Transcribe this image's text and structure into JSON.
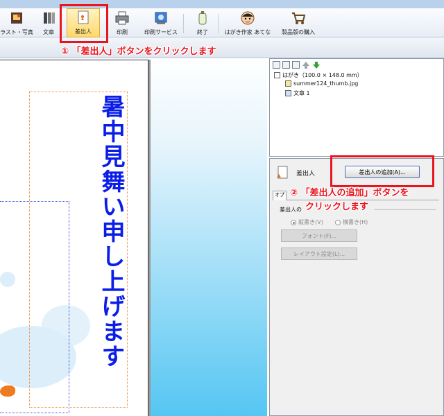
{
  "toolbar": {
    "items": [
      {
        "label": "ラスト・写真",
        "icon": "illustration-photo-icon"
      },
      {
        "label": "文章",
        "icon": "text-icon"
      },
      {
        "label": "差出人",
        "icon": "sender-icon"
      },
      {
        "label": "印刷",
        "icon": "printer-icon"
      },
      {
        "label": "印刷サービス",
        "icon": "print-service-icon"
      },
      {
        "label": "終了",
        "icon": "exit-icon"
      },
      {
        "label": "はがき作家 あてな",
        "icon": "hagaki-address-icon"
      },
      {
        "label": "製品版の購入",
        "icon": "cart-icon"
      }
    ]
  },
  "callouts": {
    "step1": "① 「差出人」ボタンをクリックします",
    "step2_line1": "② 「差出人の追加」ボタンを",
    "step2_line2": "クリックします"
  },
  "card": {
    "vertical_text": "暑中見舞い申し上げます"
  },
  "tree": {
    "root": "はがき（100.0 × 148.0 mm）",
    "children": [
      "summer124_thumb.jpg",
      "文章 1"
    ]
  },
  "sender_panel": {
    "title": "差出人",
    "add_button": "差出人の追加(A)...",
    "tab_label": "オプ",
    "group_label": "差出人の",
    "radio_vertical": "縦書き(V)",
    "radio_horizontal": "横書き(H)",
    "font_button": "フォント(F)...",
    "layout_button": "レイアウト設定(L)..."
  },
  "colors": {
    "highlight": "#e8141e",
    "card_text": "#0b1ee8",
    "workarea_gradient_end": "#55c6f3"
  }
}
